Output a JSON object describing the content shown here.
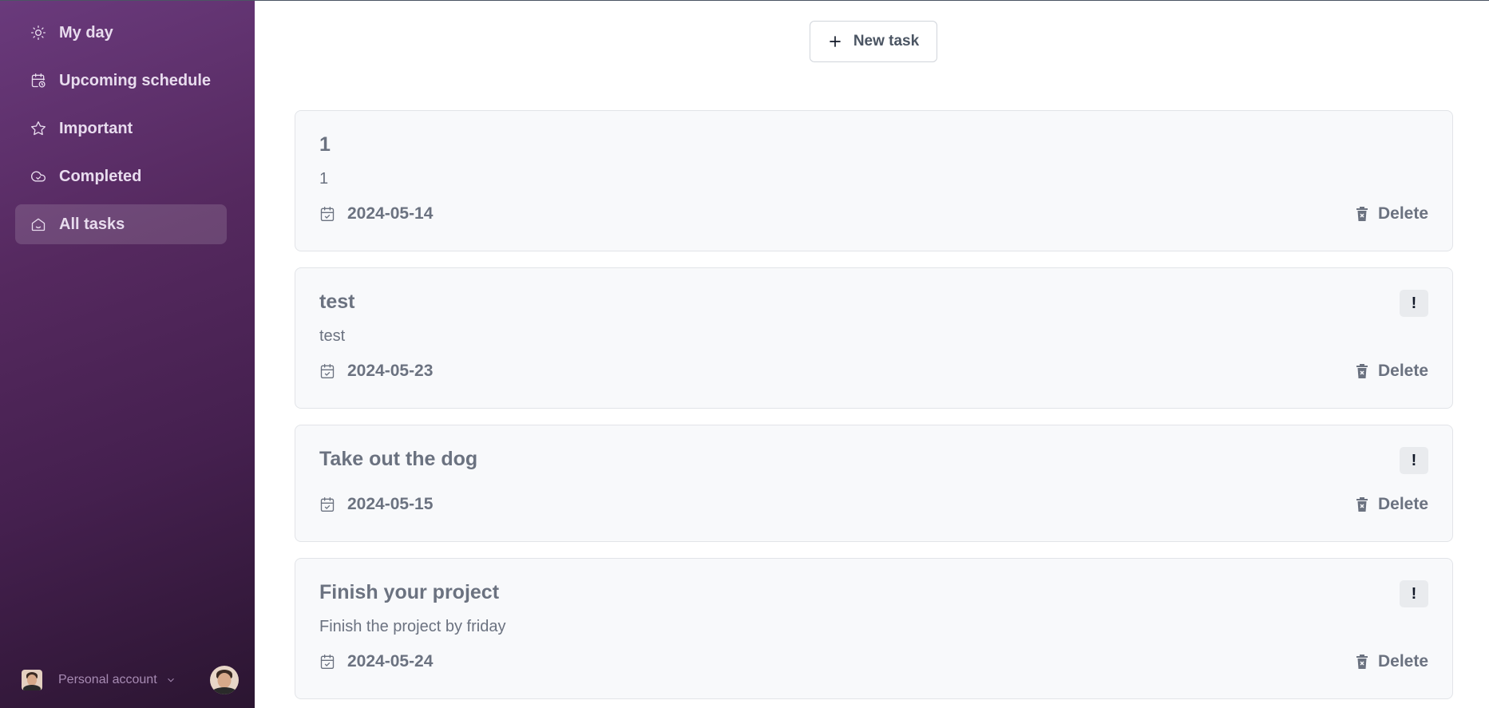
{
  "sidebar": {
    "items": [
      {
        "label": "My day",
        "icon": "sun-icon",
        "active": false
      },
      {
        "label": "Upcoming schedule",
        "icon": "calendar-clock-icon",
        "active": false
      },
      {
        "label": "Important",
        "icon": "star-icon",
        "active": false
      },
      {
        "label": "Completed",
        "icon": "cloud-check-icon",
        "active": false
      },
      {
        "label": "All tasks",
        "icon": "home-icon",
        "active": true
      }
    ],
    "account_label": "Personal account"
  },
  "toolbar": {
    "new_task_label": "New task"
  },
  "tasks": [
    {
      "title": "1",
      "description": "1",
      "date": "2024-05-14",
      "important_flag": "",
      "delete_label": "Delete"
    },
    {
      "title": "test",
      "description": "test",
      "date": "2024-05-23",
      "important_flag": "!",
      "delete_label": "Delete"
    },
    {
      "title": "Take out the dog",
      "description": "",
      "date": "2024-05-15",
      "important_flag": "!",
      "delete_label": "Delete"
    },
    {
      "title": "Finish your project",
      "description": "Finish the project by friday",
      "date": "2024-05-24",
      "important_flag": "!",
      "delete_label": "Delete"
    }
  ],
  "colors": {
    "sidebar_top": "#6a3a7c",
    "sidebar_bottom": "#2b1531",
    "card_bg": "#f8f9fb",
    "text": "#6b7280"
  }
}
